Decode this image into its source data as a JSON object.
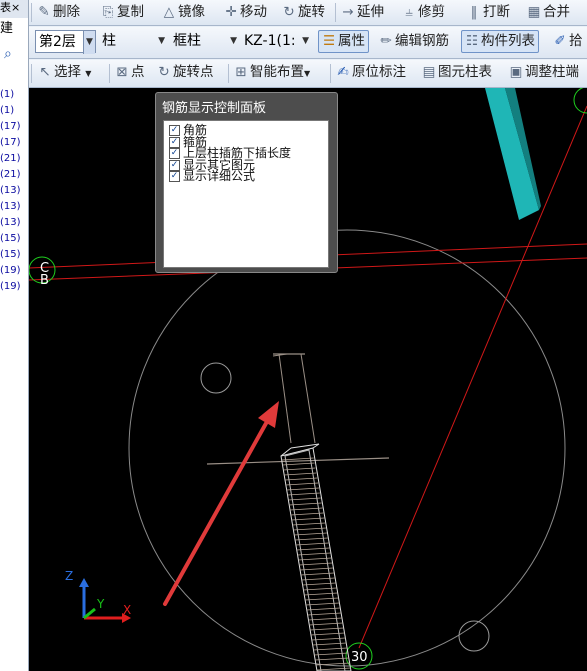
{
  "left_strip": {
    "close_label": "表×",
    "build_label": "建",
    "row_numbers": [
      "(1)",
      "(1)",
      "(17)",
      "(17)",
      "(21)",
      "(21)",
      "(13)",
      "(13)",
      "(13)",
      "(15)",
      "(15)",
      "(19)",
      "(19)"
    ]
  },
  "toolbar1": {
    "delete": "删除",
    "copy": "复制",
    "mirror": "镜像",
    "move": "移动",
    "rotate": "旋转",
    "extend": "延伸",
    "trim": "修剪",
    "break": "打断",
    "merge": "合并"
  },
  "toolbar2": {
    "floor": "第2层",
    "category": "柱",
    "type": "框柱",
    "component": "KZ-1(1:",
    "properties": "属性",
    "edit_rebar": "编辑钢筋",
    "component_list": "构件列表",
    "pick": "拾"
  },
  "toolbar3": {
    "select": "选择",
    "point": "点",
    "rotate_point": "旋转点",
    "smart_layout": "智能布置",
    "in_place_label": "原位标注",
    "element_column_table": "图元柱表",
    "adjust_column_end": "调整柱端"
  },
  "panel": {
    "title": "钢筋显示控制面板",
    "options": [
      {
        "label": "角筋",
        "checked": true
      },
      {
        "label": "箍筋",
        "checked": true
      },
      {
        "label": "上层柱插筋下插长度",
        "checked": true
      },
      {
        "label": "显示其它图元",
        "checked": true
      },
      {
        "label": "显示详细公式",
        "checked": true
      }
    ]
  },
  "canvas": {
    "axis_label_c": "C",
    "axis_label_b": "B",
    "axis_label_30": "30",
    "axis_x": "X",
    "axis_y": "Y",
    "axis_z": "Z",
    "colors": {
      "background": "#000000",
      "grid_line": "#d01818",
      "column_3d": "#1fb6b6",
      "arrow": "#e03a3a",
      "axis_circle": "#1fd01f"
    }
  }
}
